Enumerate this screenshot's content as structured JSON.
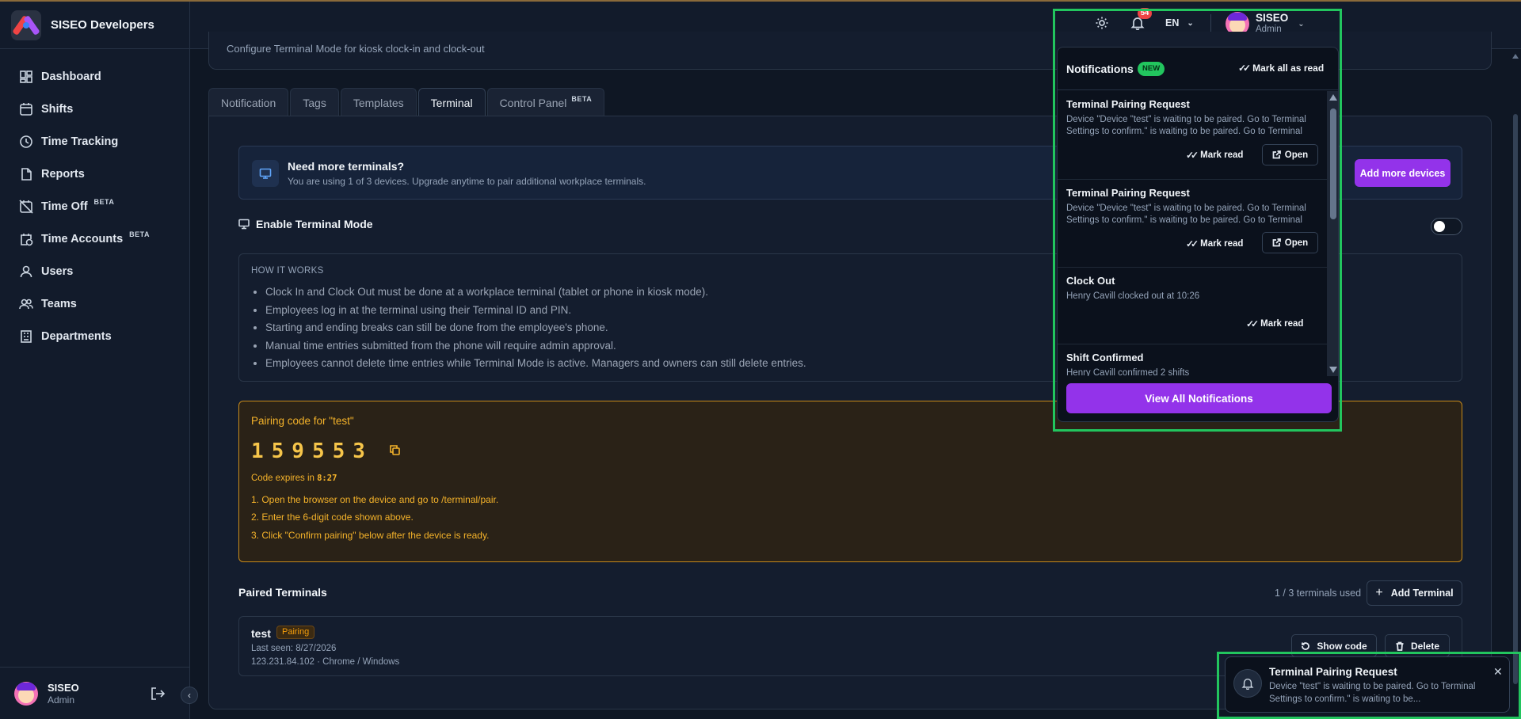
{
  "app": {
    "name": "SISEO Developers"
  },
  "sidebar": {
    "items": [
      {
        "label": "Dashboard",
        "icon": "dashboard-icon",
        "beta": ""
      },
      {
        "label": "Shifts",
        "icon": "calendar-icon",
        "beta": ""
      },
      {
        "label": "Time Tracking",
        "icon": "clock-icon",
        "beta": ""
      },
      {
        "label": "Reports",
        "icon": "document-icon",
        "beta": ""
      },
      {
        "label": "Time Off",
        "icon": "calendar-off-icon",
        "beta": "BETA"
      },
      {
        "label": "Time Accounts",
        "icon": "calendar-clock-icon",
        "beta": "BETA"
      },
      {
        "label": "Users",
        "icon": "user-icon",
        "beta": ""
      },
      {
        "label": "Teams",
        "icon": "users-icon",
        "beta": ""
      },
      {
        "label": "Departments",
        "icon": "building-icon",
        "beta": ""
      }
    ],
    "user": {
      "name": "SISEO",
      "role": "Admin"
    },
    "collapse_glyph": "‹"
  },
  "header": {
    "notification_count": "54",
    "language": "EN",
    "user": {
      "name": "SISEO",
      "role": "Admin"
    }
  },
  "page": {
    "subtitle": "Configure Terminal Mode for kiosk clock-in and clock-out",
    "tabs": [
      {
        "label": "Notification",
        "beta": ""
      },
      {
        "label": "Tags",
        "beta": ""
      },
      {
        "label": "Templates",
        "beta": ""
      },
      {
        "label": "Terminal",
        "beta": ""
      },
      {
        "label": "Control Panel",
        "beta": "BETA"
      }
    ],
    "active_tab": "Terminal",
    "upsell": {
      "title": "Need more terminals?",
      "text": "You are using 1 of 3 devices. Upgrade anytime to pair additional workplace terminals.",
      "button": "Add more devices"
    },
    "terminal_mode": {
      "label": "Enable Terminal Mode",
      "enabled": false
    },
    "how_it_works": {
      "heading": "HOW IT WORKS",
      "items": [
        "Clock In and Clock Out must be done at a workplace terminal (tablet or phone in kiosk mode).",
        "Employees log in at the terminal using their Terminal ID and PIN.",
        "Starting and ending breaks can still be done from the employee's phone.",
        "Manual time entries submitted from the phone will require admin approval.",
        "Employees cannot delete time entries while Terminal Mode is active. Managers and owners can still delete entries."
      ]
    },
    "pairing": {
      "title": "Pairing code for \"test\"",
      "code": "159553",
      "expires_label": "Code expires in",
      "expires_value": "8:27",
      "steps": [
        "1. Open the browser on the device and go to /terminal/pair.",
        "2. Enter the 6-digit code shown above.",
        "3. Click \"Confirm pairing\" below after the device is ready."
      ]
    },
    "paired": {
      "heading": "Paired Terminals",
      "usage": "1 / 3 terminals used",
      "add_button": "Add Terminal",
      "terminals": [
        {
          "name": "test",
          "status": "Pairing",
          "last_seen": "Last seen: 8/27/2026",
          "meta": "123.231.84.102 · Chrome / Windows",
          "show_code": "Show code",
          "delete": "Delete"
        }
      ]
    }
  },
  "notifications": {
    "title": "Notifications",
    "new_badge": "NEW",
    "mark_all": "Mark all as read",
    "mark_read": "Mark read",
    "open": "Open",
    "items": [
      {
        "title": "Terminal Pairing Request",
        "text": "Device \"Device \"test\" is waiting to be paired. Go to Terminal Settings to confirm.\" is waiting to be paired. Go to Terminal Settings to confirm."
      },
      {
        "title": "Terminal Pairing Request",
        "text": "Device \"Device \"test\" is waiting to be paired. Go to Terminal Settings to confirm.\" is waiting to be paired. Go to Terminal Settings to confirm."
      },
      {
        "title": "Clock Out",
        "text": "Henry Cavill clocked out at 10:26"
      },
      {
        "title": "Shift Confirmed",
        "text": "Henry Cavill confirmed 2 shifts"
      }
    ],
    "view_all": "View All Notifications"
  },
  "toast": {
    "title": "Terminal Pairing Request",
    "text": "Device \"test\" is waiting to be paired. Go to Terminal Settings to confirm.\" is waiting to be..."
  },
  "colors": {
    "accent": "#9333ea",
    "success": "#22c55e",
    "warning": "#f5b32a",
    "danger": "#ef4444",
    "background": "#0f1724"
  }
}
